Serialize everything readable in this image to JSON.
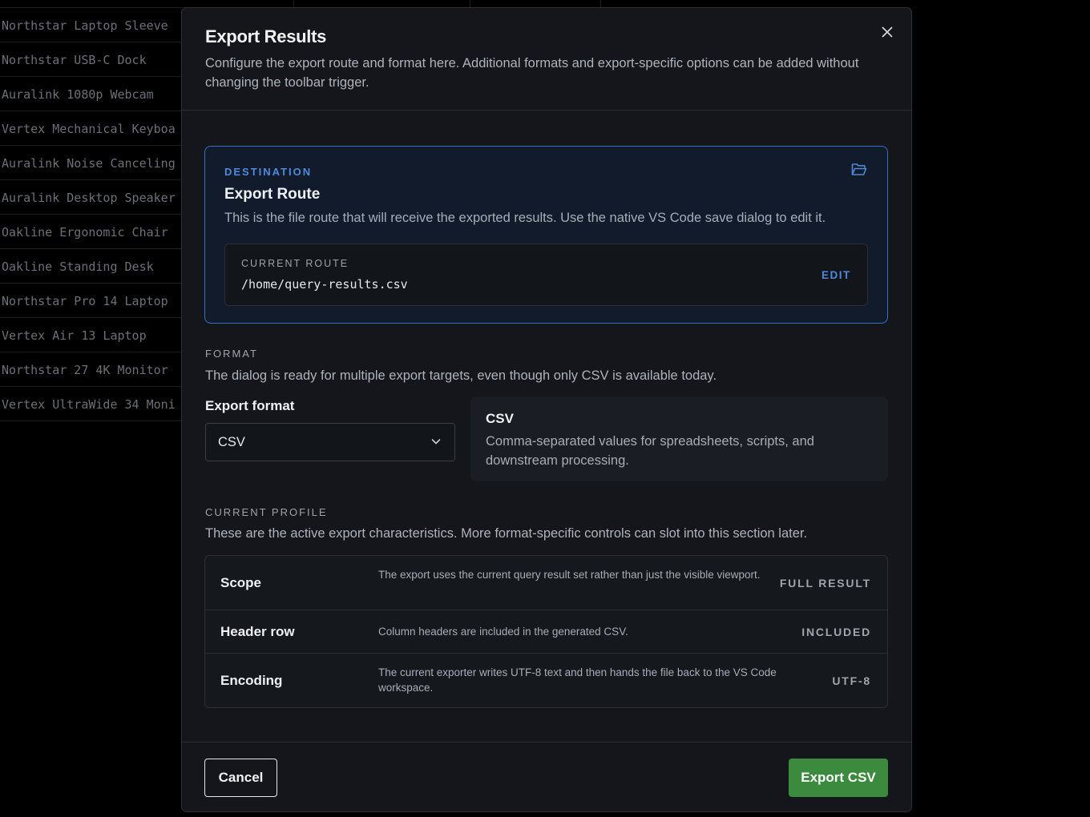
{
  "background_table": {
    "rows": [
      "Northstar Laptop Sleeve",
      "Northstar USB-C Dock",
      "Auralink 1080p Webcam",
      "Vertex Mechanical Keyboa",
      "Auralink Noise Canceling",
      "Auralink Desktop Speaker",
      "Oakline Ergonomic Chair",
      "Oakline Standing Desk",
      "Northstar Pro 14 Laptop",
      "Vertex Air 13 Laptop",
      "Northstar 27 4K Monitor",
      "Vertex UltraWide 34 Moni"
    ]
  },
  "dialog": {
    "title": "Export Results",
    "description": "Configure the export route and format here. Additional formats and export-specific options can be added without changing the toolbar trigger.",
    "close_icon": "close-icon"
  },
  "destination": {
    "eyebrow": "DESTINATION",
    "title": "Export Route",
    "description": "This is the file route that will receive the exported results. Use the native VS Code save dialog to edit it.",
    "icon": "folder-open-icon",
    "accent_color": "#3670c4",
    "route_label": "CURRENT ROUTE",
    "route_value": "/home/query-results.csv",
    "edit_label": "EDIT"
  },
  "format": {
    "section_label": "FORMAT",
    "section_description": "The dialog is ready for multiple export targets, even though only CSV is available today.",
    "field_label": "Export format",
    "selected": "CSV",
    "info_title": "CSV",
    "info_description": "Comma-separated values for spreadsheets, scripts, and downstream processing."
  },
  "profile": {
    "section_label": "CURRENT PROFILE",
    "section_description": "These are the active export characteristics. More format-specific controls can slot into this section later.",
    "rows": [
      {
        "name": "Scope",
        "description": "The export uses the current query result set rather than just the visible viewport.",
        "value": "FULL RESULT"
      },
      {
        "name": "Header row",
        "description": "Column headers are included in the generated CSV.",
        "value": "INCLUDED"
      },
      {
        "name": "Encoding",
        "description": "The current exporter writes UTF-8 text and then hands the file back to the VS Code workspace.",
        "value": "UTF-8"
      }
    ]
  },
  "footer": {
    "cancel_label": "Cancel",
    "export_label": "Export CSV",
    "export_color": "#3b8a3e"
  }
}
